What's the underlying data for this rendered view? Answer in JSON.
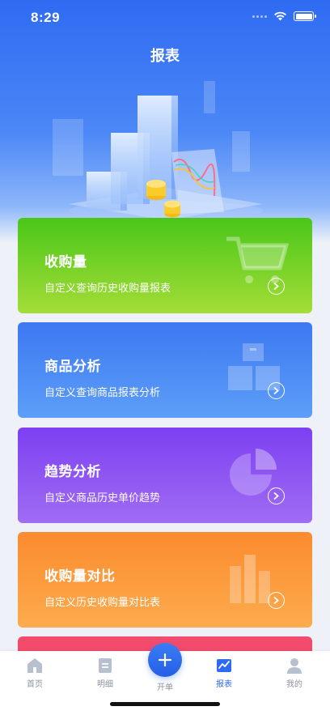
{
  "status_bar": {
    "time": "8:29"
  },
  "header": {
    "title": "报表"
  },
  "cards": [
    {
      "title": "收购量",
      "desc": "自定义查询历史收购量报表",
      "icon": "cart-icon"
    },
    {
      "title": "商品分析",
      "desc": "自定义查询商品报表分析",
      "icon": "boxes-icon"
    },
    {
      "title": "趋势分析",
      "desc": "自定义商品历史单价趋势",
      "icon": "pie-chart-icon"
    },
    {
      "title": "收购量对比",
      "desc": "自定义历史收购量对比表",
      "icon": "bar-chart-icon"
    }
  ],
  "tabbar": {
    "home": "首页",
    "detail": "明细",
    "create": "开单",
    "report": "报表",
    "mine": "我的"
  },
  "colors": {
    "primary": "#2f6bf2",
    "card_purchase": "#4ac619",
    "card_goods": "#3d78f2",
    "card_trend": "#7d40f2",
    "card_compare": "#fb8b2e",
    "card_partial": "#f24b6c"
  }
}
